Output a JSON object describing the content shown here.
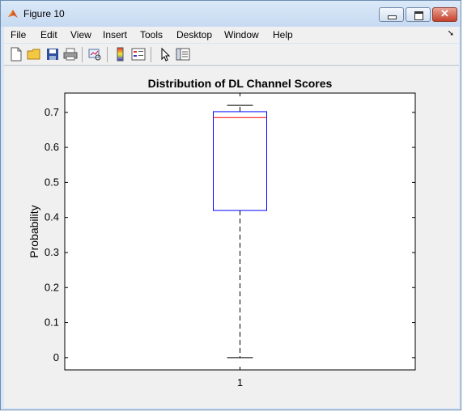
{
  "window": {
    "title": "Figure 10"
  },
  "menu": [
    "File",
    "Edit",
    "View",
    "Insert",
    "Tools",
    "Desktop",
    "Window",
    "Help"
  ],
  "toolbar_icons": [
    "new-figure-icon",
    "open-file-icon",
    "save-icon",
    "print-icon",
    "link-plot-icon",
    "colorbar-icon",
    "legend-icon",
    "pointer-icon",
    "property-editor-icon"
  ],
  "chart_data": {
    "type": "box",
    "title": "Distribution of DL Channel Scores",
    "xlabel": "",
    "ylabel": "Probability",
    "categories": [
      "1"
    ],
    "ylim": [
      -0.035,
      0.755
    ],
    "yticks": [
      0,
      0.1,
      0.2,
      0.3,
      0.4,
      0.5,
      0.6,
      0.7
    ],
    "ytick_labels": [
      "0",
      "0.1",
      "0.2",
      "0.3",
      "0.4",
      "0.5",
      "0.6",
      "0.7"
    ],
    "boxes": [
      {
        "category": "1",
        "whisker_low": 0.0,
        "q1": 0.42,
        "median": 0.685,
        "q3": 0.702,
        "whisker_high": 0.72
      }
    ],
    "colors": {
      "box": "#0000ff",
      "median": "#ff0000",
      "whisker": "#000000"
    }
  }
}
